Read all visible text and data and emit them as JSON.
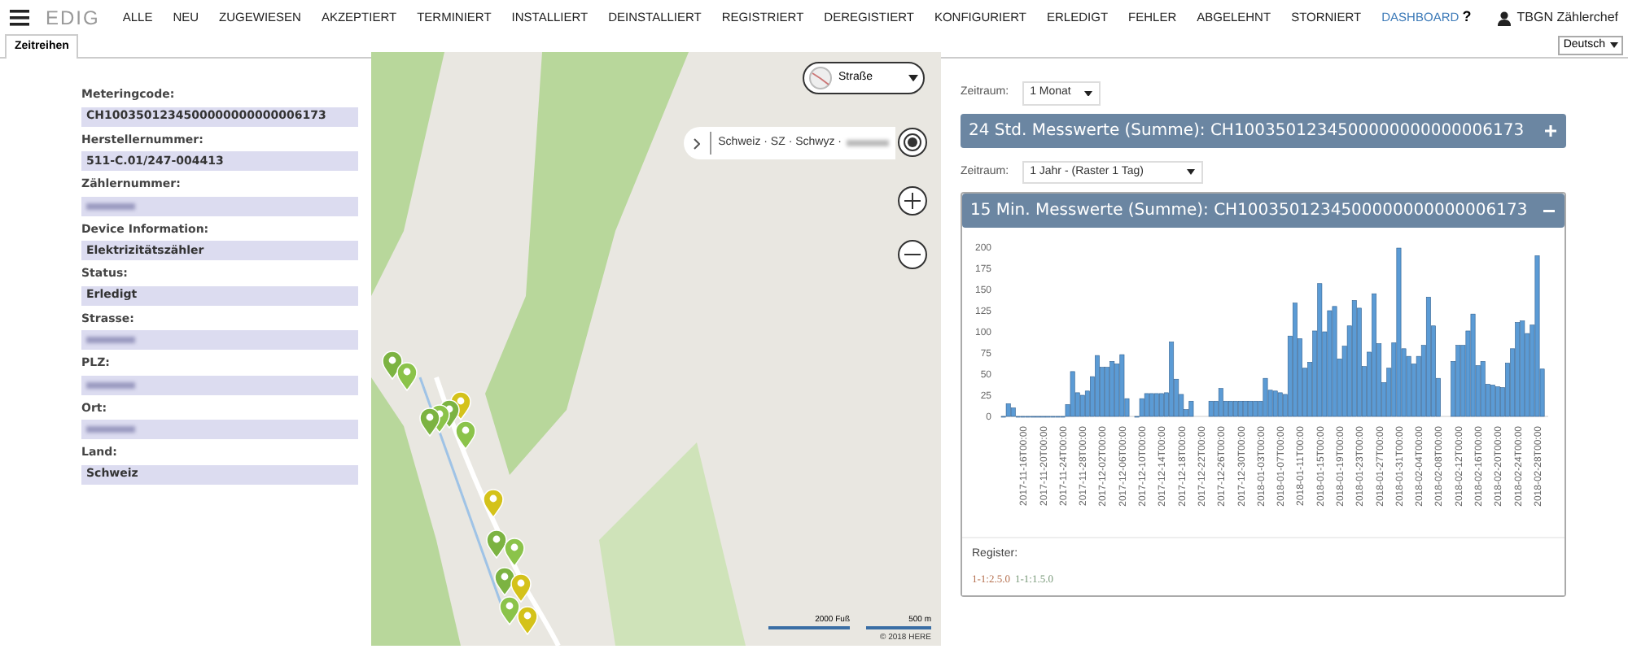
{
  "nav": {
    "logo": "EDIG",
    "items": [
      {
        "label": "ALLE",
        "selected": false
      },
      {
        "label": "NEU",
        "selected": false
      },
      {
        "label": "ZUGEWIESEN",
        "selected": false
      },
      {
        "label": "AKZEPTIERT",
        "selected": false
      },
      {
        "label": "TERMINIERT",
        "selected": false
      },
      {
        "label": "INSTALLIERT",
        "selected": false
      },
      {
        "label": "DEINSTALLIERT",
        "selected": false
      },
      {
        "label": "REGISTRIERT",
        "selected": false
      },
      {
        "label": "DEREGISTIERT",
        "selected": false
      },
      {
        "label": "KONFIGURIERT",
        "selected": false
      },
      {
        "label": "ERLEDIGT",
        "selected": false
      },
      {
        "label": "FEHLER",
        "selected": false
      },
      {
        "label": "ABGELEHNT",
        "selected": false
      },
      {
        "label": "STORNIERT",
        "selected": false
      },
      {
        "label": "DASHBOARD",
        "selected": true
      }
    ],
    "help": "?",
    "user": "TBGN Zählerchef"
  },
  "tabs": [
    {
      "label": "Zeitreihen",
      "selected": true
    }
  ],
  "language": "Deutsch",
  "fields": [
    {
      "label": "Meteringcode:",
      "value": "CH1003501234500000000000006173",
      "redacted": false
    },
    {
      "label": "Herstellernummer:",
      "value": "511-C.01/247-004413",
      "redacted": false
    },
    {
      "label": "Zählernummer:",
      "redacted": true
    },
    {
      "label": "Device Information:",
      "value": "Elektrizitätszähler",
      "redacted": false
    },
    {
      "label": "Status:",
      "value": "Erledigt",
      "redacted": false
    },
    {
      "label": "Strasse:",
      "redacted": true
    },
    {
      "label": "PLZ:",
      "redacted": true
    },
    {
      "label": "Ort:",
      "redacted": true
    },
    {
      "label": "Land:",
      "value": "Schweiz",
      "redacted": false
    }
  ],
  "map": {
    "layer_select": "Straße",
    "breadcrumb": "Schweiz · SZ · Schwyz ·",
    "breadcrumb_redacted": true,
    "scale_imperial": "2000 Fuß",
    "scale_metric": "500 m",
    "copyright": "© 2018 HERE"
  },
  "panels": [
    {
      "period_label": "Zeitraum:",
      "period": "1 Monat",
      "title": "24 Std. Messwerte (Summe): CH1003501234500000000000006173",
      "expanded": false
    },
    {
      "period_label": "Zeitraum:",
      "period": "1 Jahr - (Raster 1 Tag)",
      "title": "15 Min. Messwerte (Summe): CH1003501234500000000000006173",
      "expanded": true,
      "chart_data": {
        "type": "bar",
        "values": [
          0,
          15,
          10,
          0,
          0,
          0,
          0,
          0,
          0,
          0,
          0,
          0,
          0,
          14,
          53,
          28,
          25,
          30,
          47,
          72,
          58,
          58,
          65,
          62,
          73,
          21,
          null,
          0,
          21,
          27,
          27,
          27,
          27,
          28,
          88,
          44,
          26,
          8,
          18,
          null,
          null,
          null,
          18,
          18,
          33,
          18,
          18,
          18,
          18,
          18,
          18,
          18,
          18,
          45,
          31,
          30,
          28,
          26,
          95,
          134,
          92,
          57,
          64,
          101,
          157,
          100,
          125,
          130,
          68,
          83,
          107,
          137,
          128,
          59,
          76,
          145,
          86,
          40,
          57,
          87,
          199,
          80,
          71,
          62,
          71,
          84,
          141,
          107,
          45,
          null,
          null,
          65,
          84,
          84,
          101,
          121,
          60,
          65,
          38,
          37,
          35,
          34,
          63,
          80,
          111,
          113,
          98,
          108,
          190,
          56
        ],
        "ylim": [
          0,
          200
        ],
        "yticks": [
          0,
          25,
          50,
          75,
          100,
          125,
          150,
          175,
          200
        ]
      },
      "date_labels": [
        "2017-11-16T00:00",
        "2017-11-20T00:00",
        "2017-11-24T00:00",
        "2017-11-28T00:00",
        "2017-12-02T00:00",
        "2017-12-06T00:00",
        "2017-12-10T00:00",
        "2017-12-14T00:00",
        "2017-12-18T00:00",
        "2017-12-22T00:00",
        "2017-12-26T00:00",
        "2017-12-30T00:00",
        "2018-01-03T00:00",
        "2018-01-07T00:00",
        "2018-01-11T00:00",
        "2018-01-15T00:00",
        "2018-01-19T00:00",
        "2018-01-23T00:00",
        "2018-01-27T00:00",
        "2018-01-31T00:00",
        "2018-02-04T00:00",
        "2018-02-08T00:00",
        "2018-02-12T00:00",
        "2018-02-16T00:00",
        "2018-02-20T00:00",
        "2018-02-24T00:00",
        "2018-02-28T00:00"
      ],
      "register_label": "Register:",
      "registers": [
        {
          "code": "1-1:2.5.0",
          "color": "#b5704f"
        },
        {
          "code": "1-1:1.5.0",
          "color": "#7a9a7a"
        }
      ]
    }
  ]
}
